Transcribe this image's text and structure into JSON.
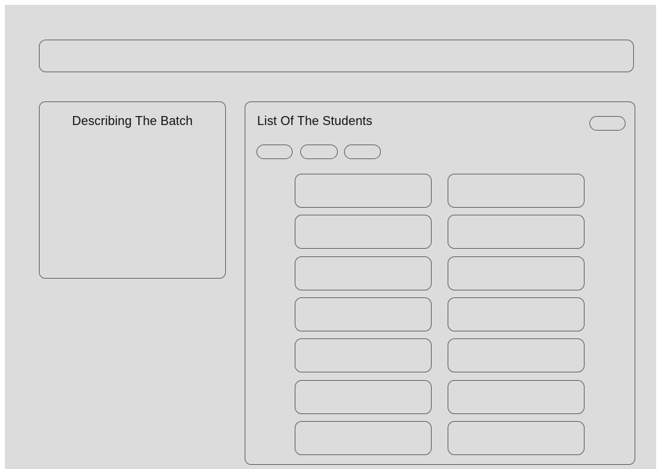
{
  "batch_panel": {
    "title": "Describing The Batch"
  },
  "students_panel": {
    "title": "List Of The Students",
    "filter_pill_count": 3,
    "student_card_rows": 7,
    "student_card_columns": 2
  }
}
